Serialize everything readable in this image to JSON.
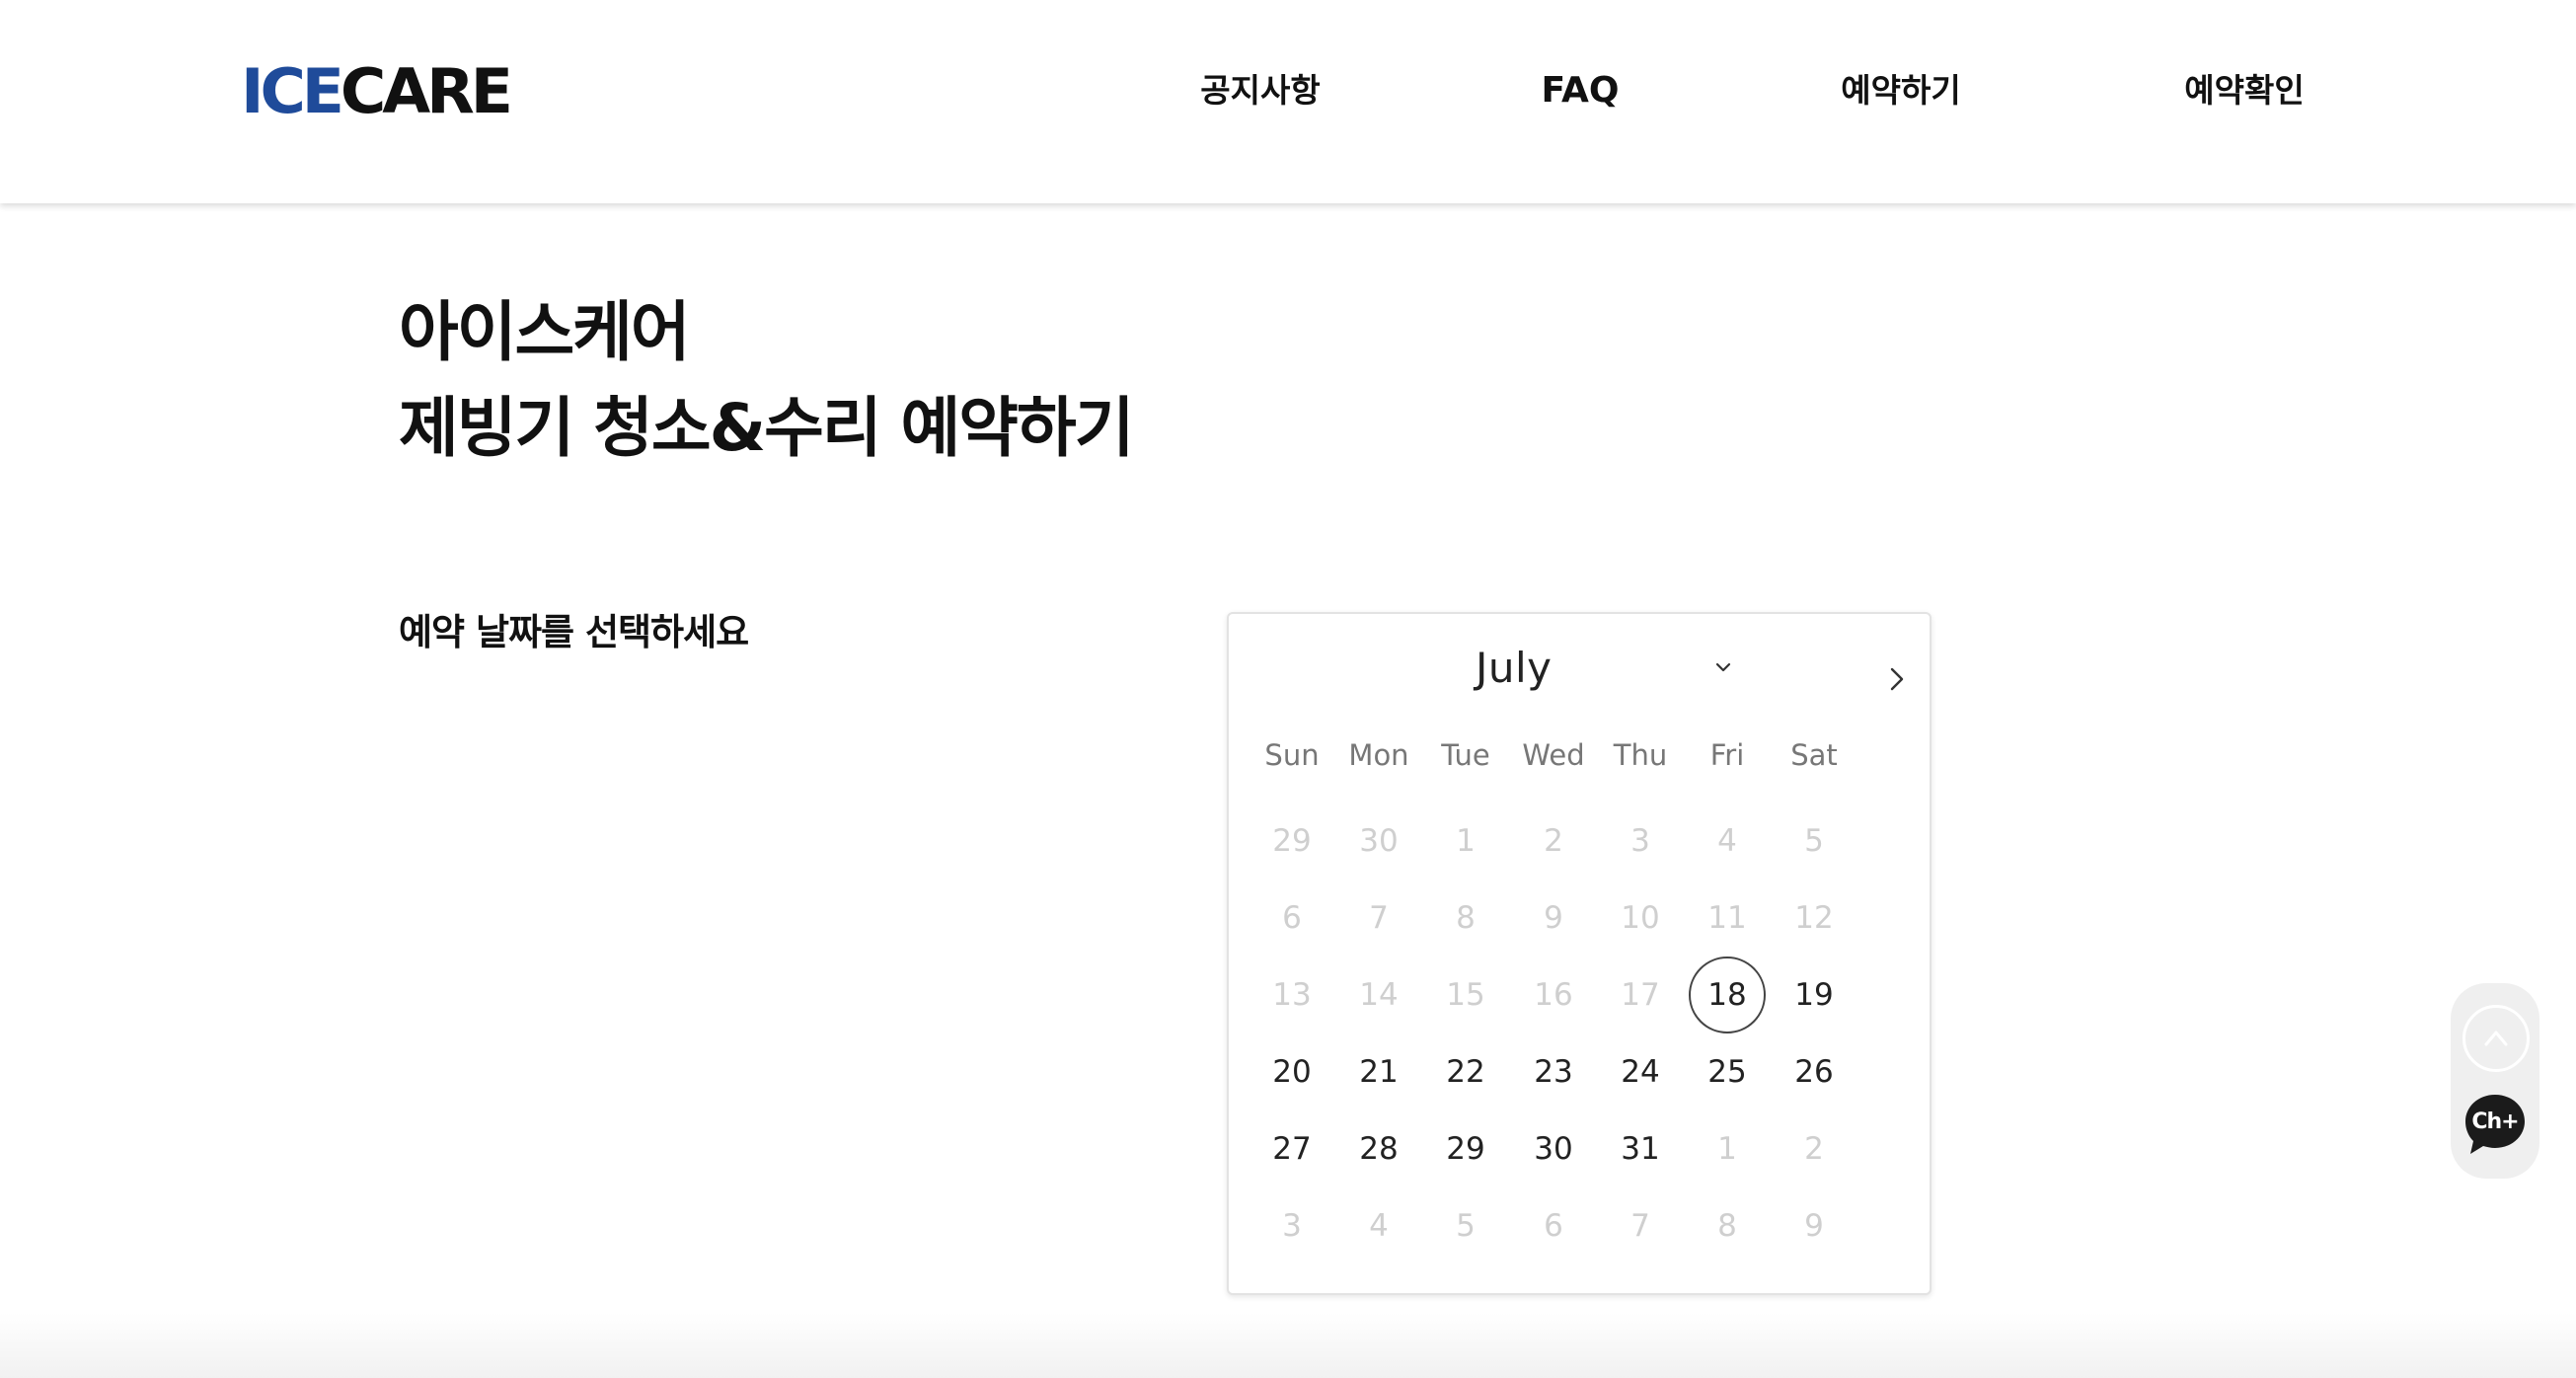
{
  "header": {
    "logo_part1": "ICE",
    "logo_part2": "CARE",
    "logo_colors": {
      "ice": "#1f4b9a",
      "care": "#111111"
    },
    "nav": [
      "공지사항",
      "FAQ",
      "예약하기",
      "예약확인"
    ]
  },
  "main": {
    "title_line1": "아이스케어",
    "title_line2": "제빙기 청소&수리 예약하기",
    "date_prompt": "예약 날짜를 선택하세요"
  },
  "calendar": {
    "month": "July",
    "month_dropdown_icon": "chevron-down-icon",
    "next_icon": "chevron-right-icon",
    "weekdays": [
      "Sun",
      "Mon",
      "Tue",
      "Wed",
      "Thu",
      "Fri",
      "Sat"
    ],
    "weeks": [
      [
        {
          "d": "29",
          "s": "muted"
        },
        {
          "d": "30",
          "s": "muted"
        },
        {
          "d": "1",
          "s": "muted"
        },
        {
          "d": "2",
          "s": "muted"
        },
        {
          "d": "3",
          "s": "muted"
        },
        {
          "d": "4",
          "s": "muted"
        },
        {
          "d": "5",
          "s": "muted"
        }
      ],
      [
        {
          "d": "6",
          "s": "muted"
        },
        {
          "d": "7",
          "s": "muted"
        },
        {
          "d": "8",
          "s": "muted"
        },
        {
          "d": "9",
          "s": "muted"
        },
        {
          "d": "10",
          "s": "muted"
        },
        {
          "d": "11",
          "s": "muted"
        },
        {
          "d": "12",
          "s": "muted"
        }
      ],
      [
        {
          "d": "13",
          "s": "muted"
        },
        {
          "d": "14",
          "s": "muted"
        },
        {
          "d": "15",
          "s": "muted"
        },
        {
          "d": "16",
          "s": "muted"
        },
        {
          "d": "17",
          "s": "muted"
        },
        {
          "d": "18",
          "s": "selected"
        },
        {
          "d": "19",
          "s": "avail"
        }
      ],
      [
        {
          "d": "20",
          "s": "avail"
        },
        {
          "d": "21",
          "s": "avail"
        },
        {
          "d": "22",
          "s": "avail"
        },
        {
          "d": "23",
          "s": "avail"
        },
        {
          "d": "24",
          "s": "avail"
        },
        {
          "d": "25",
          "s": "avail"
        },
        {
          "d": "26",
          "s": "avail"
        }
      ],
      [
        {
          "d": "27",
          "s": "avail"
        },
        {
          "d": "28",
          "s": "avail"
        },
        {
          "d": "29",
          "s": "avail"
        },
        {
          "d": "30",
          "s": "avail"
        },
        {
          "d": "31",
          "s": "avail"
        },
        {
          "d": "1",
          "s": "muted"
        },
        {
          "d": "2",
          "s": "muted"
        }
      ],
      [
        {
          "d": "3",
          "s": "muted"
        },
        {
          "d": "4",
          "s": "muted"
        },
        {
          "d": "5",
          "s": "muted"
        },
        {
          "d": "6",
          "s": "muted"
        },
        {
          "d": "7",
          "s": "muted"
        },
        {
          "d": "8",
          "s": "muted"
        },
        {
          "d": "9",
          "s": "muted"
        }
      ]
    ]
  },
  "floating": {
    "top_icon": "scroll-top-icon",
    "chat_label": "Ch+",
    "chat_icon": "chat-bubble-icon"
  }
}
